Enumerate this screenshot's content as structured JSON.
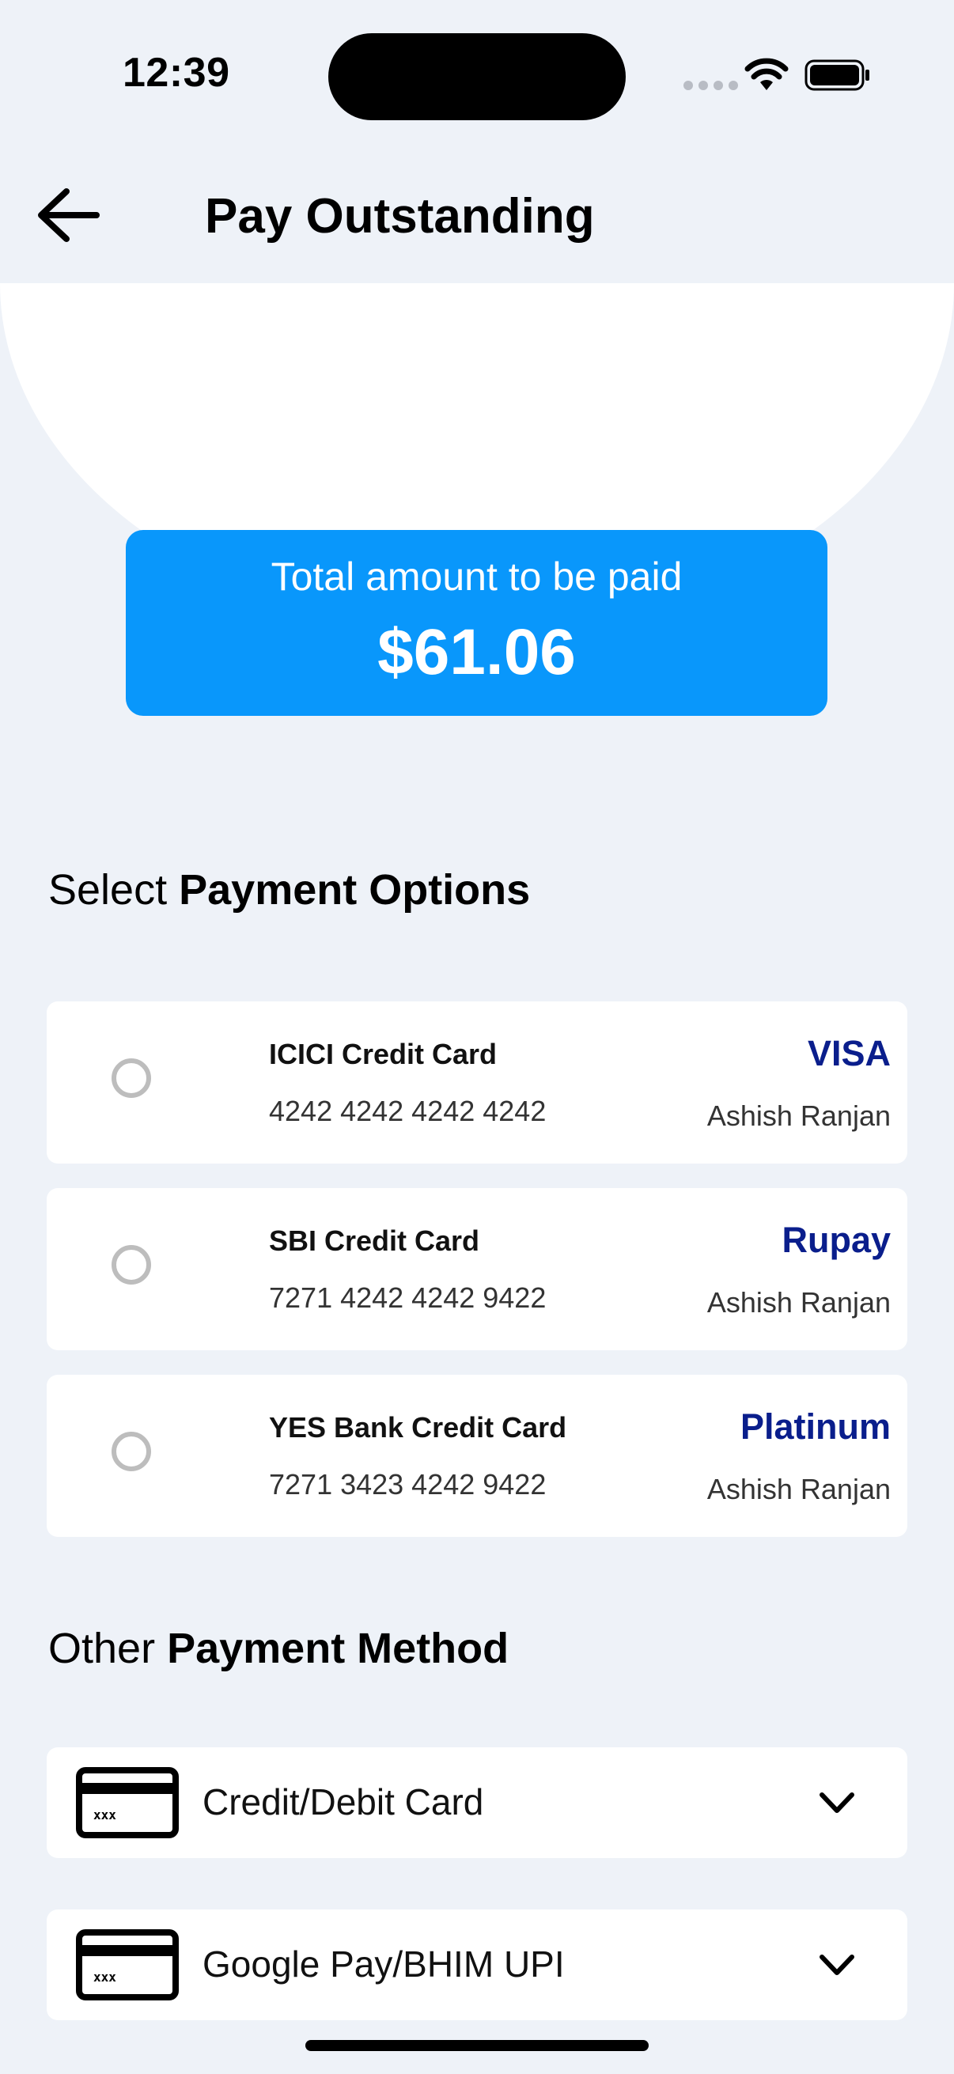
{
  "status_bar": {
    "time": "12:39"
  },
  "header": {
    "title": "Pay Outstanding"
  },
  "amount": {
    "label": "Total amount to be paid",
    "value": "$61.06"
  },
  "payment_options": {
    "prefix": "Select",
    "title": "Payment Options",
    "cards": [
      {
        "name": "ICICI Credit Card",
        "number": "4242 4242 4242 4242",
        "brand": "VISA",
        "holder": "Ashish Ranjan"
      },
      {
        "name": "SBI Credit Card",
        "number": "7271 4242 4242 9422",
        "brand": "Rupay",
        "holder": "Ashish Ranjan"
      },
      {
        "name": "YES Bank Credit Card",
        "number": "7271 3423 4242 9422",
        "brand": "Platinum",
        "holder": "Ashish Ranjan"
      }
    ]
  },
  "other_methods": {
    "prefix": "Other",
    "title": "Payment Method",
    "items": [
      {
        "label": "Credit/Debit Card",
        "icon": "credit-card-icon"
      },
      {
        "label": "Google Pay/BHIM UPI",
        "icon": "credit-card-icon"
      }
    ]
  },
  "colors": {
    "accent": "#0997fb",
    "brand_text": "#0a1e8c",
    "background": "#eef2f8"
  }
}
